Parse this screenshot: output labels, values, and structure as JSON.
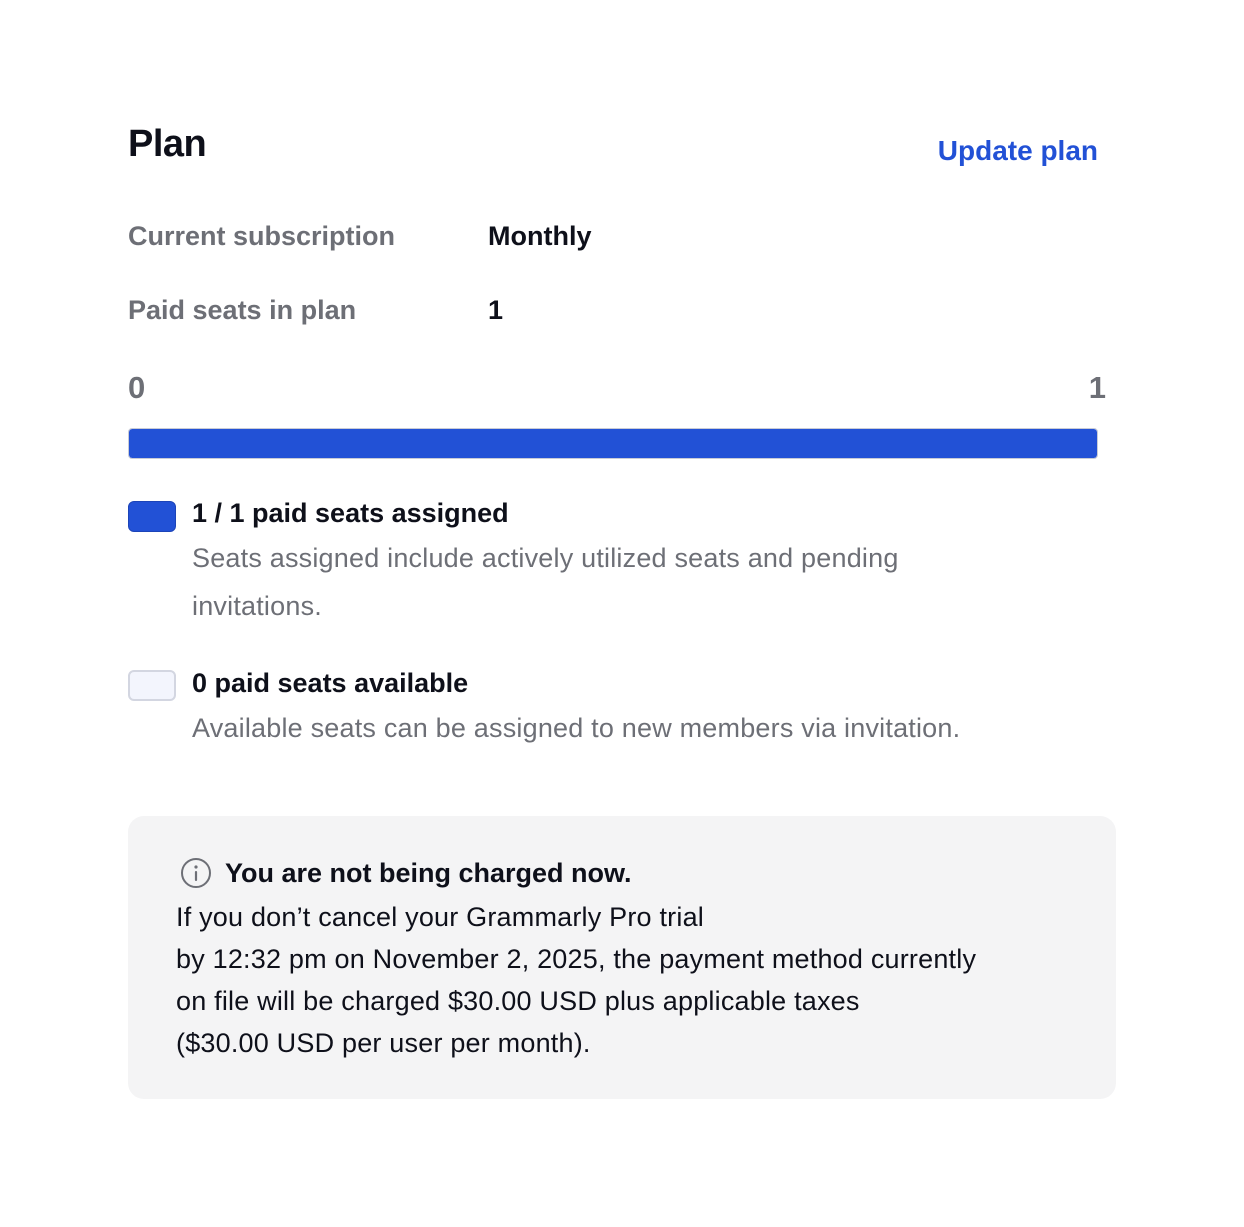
{
  "header": {
    "title": "Plan",
    "update_label": "Update plan"
  },
  "subscription": {
    "label": "Current subscription",
    "value": "Monthly"
  },
  "seats": {
    "label": "Paid seats in plan",
    "value": "1"
  },
  "usage_bar": {
    "min_label": "0",
    "max_label": "1",
    "assigned": 1,
    "total": 1,
    "fill_color": "#2251d6"
  },
  "legend": {
    "assigned": {
      "title": "1 / 1 paid seats assigned",
      "description": "Seats assigned include actively utilized seats and pending invitations.",
      "swatch_color": "#2251d6"
    },
    "available": {
      "title": "0 paid seats available",
      "description": "Available seats can be assigned to new members via invitation.",
      "swatch_color": "#f3f5fd"
    }
  },
  "notice": {
    "icon": "info-icon",
    "title": "You are not being charged now.",
    "lines": [
      "If you don’t cancel your Grammarly Pro trial",
      "by 12:32 pm on November 2, 2025, the payment method currently",
      "on file will be charged $30.00 USD plus applicable taxes",
      "($30.00 USD per user per month)."
    ]
  }
}
